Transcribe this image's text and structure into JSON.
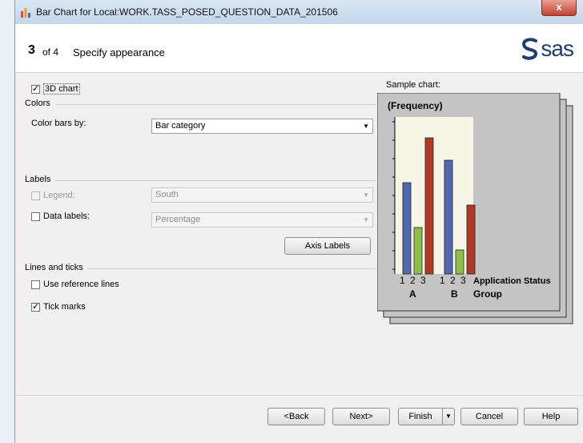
{
  "window": {
    "title": "Bar Chart for Local:WORK.TASS_POSED_QUESTION_DATA_201506",
    "close_label": "x"
  },
  "header": {
    "step_number": "3",
    "step_of": "of 4",
    "step_title": "Specify appearance",
    "logo_text": "sas"
  },
  "options": {
    "chart3d_label": "3D chart",
    "chart3d_checked": true
  },
  "colors_section": {
    "title": "Colors",
    "color_bars_label": "Color bars by:",
    "color_bars_value": "Bar category"
  },
  "labels_section": {
    "title": "Labels",
    "legend_label": "Legend:",
    "legend_value": "South",
    "data_labels_label": "Data labels:",
    "data_labels_value": "Percentage",
    "axis_labels_button": "Axis Labels"
  },
  "lines_section": {
    "title": "Lines and ticks",
    "reference_lines_label": "Use reference lines",
    "tick_marks_label": "Tick marks"
  },
  "sample": {
    "label": "Sample chart:",
    "y_title": "(Frequency)",
    "group_labels": [
      "A",
      "B"
    ],
    "bar_ticks": [
      "1",
      "2",
      "3",
      "1",
      "2",
      "3"
    ],
    "x_title_line1": "Application Status",
    "x_title_line2": "Group",
    "colors": {
      "bar1": "#5068b0",
      "bar2": "#8fbf4a",
      "bar3": "#b03a25",
      "plot_bg": "#f6f5e6",
      "panel": "#c4c4c4"
    }
  },
  "buttons": {
    "back": "Back",
    "next": "Next>",
    "finish": "Finish",
    "cancel": "Cancel",
    "help": "Help"
  }
}
